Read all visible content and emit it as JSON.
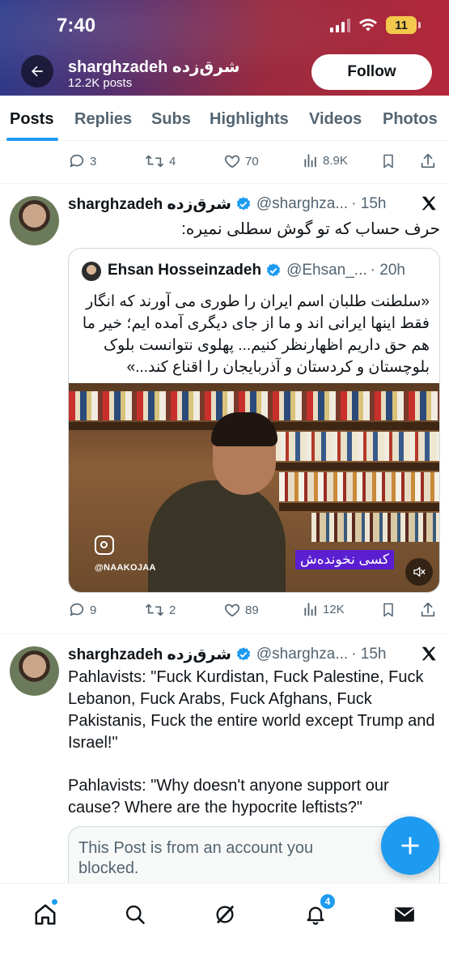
{
  "status_bar": {
    "time": "7:40",
    "battery": "11"
  },
  "header": {
    "name": "sharghzadeh شرق‌زده",
    "posts_count": "12.2K posts",
    "follow_label": "Follow"
  },
  "tabs": [
    {
      "label": "Posts",
      "active": true
    },
    {
      "label": "Replies"
    },
    {
      "label": "Subs"
    },
    {
      "label": "Highlights"
    },
    {
      "label": "Videos"
    },
    {
      "label": "Photos"
    }
  ],
  "prev_post_actions": {
    "replies": "3",
    "reposts": "4",
    "likes": "70",
    "views": "8.9K"
  },
  "tweet1": {
    "name": "sharghzadeh شرق‌زده",
    "handle": "@sharghza...",
    "time": "· 15h",
    "text": "حرف حساب که تو گوش سطلی نمیره:",
    "quote": {
      "name": "Ehsan Hosseinzadeh",
      "handle": "@Ehsan_...",
      "time": "· 20h",
      "text": "«سلطنت طلبان اسم ایران را طوری می آورند که انگار فقط اینها ایرانی اند و ما از جای دیگری آمده ایم؛ خیر ما هم حق داریم اظهارنظر کنیم... پهلوی نتوانست بلوک بلوچستان و کردستان و آذربایجان را اقناع کند...»",
      "media_watermark": "@NAAKOJAA",
      "media_caption": "کسی نخونده‌ش"
    },
    "actions": {
      "replies": "9",
      "reposts": "2",
      "likes": "89",
      "views": "12K"
    }
  },
  "tweet2": {
    "name": "sharghzadeh شرق‌زده",
    "handle": "@sharghza...",
    "time": "· 15h",
    "text_line1": "Pahlavists: \"Fuck Kurdistan, Fuck Palestine, Fuck Lebanon, Fuck Arabs, Fuck Afghans, Fuck Pakistanis, Fuck the entire world except Trump and Israel!\"",
    "text_line2": "Pahlavists: \"Why doesn't anyone support our cause? Where are the hypocrite leftists?\"",
    "blocked_notice": "This Post is from an account you blocked."
  },
  "bottom_nav": {
    "notifications_badge": "4"
  },
  "colors": {
    "accent": "#1d9bf0",
    "text": "#0f1419",
    "muted": "#536471"
  }
}
